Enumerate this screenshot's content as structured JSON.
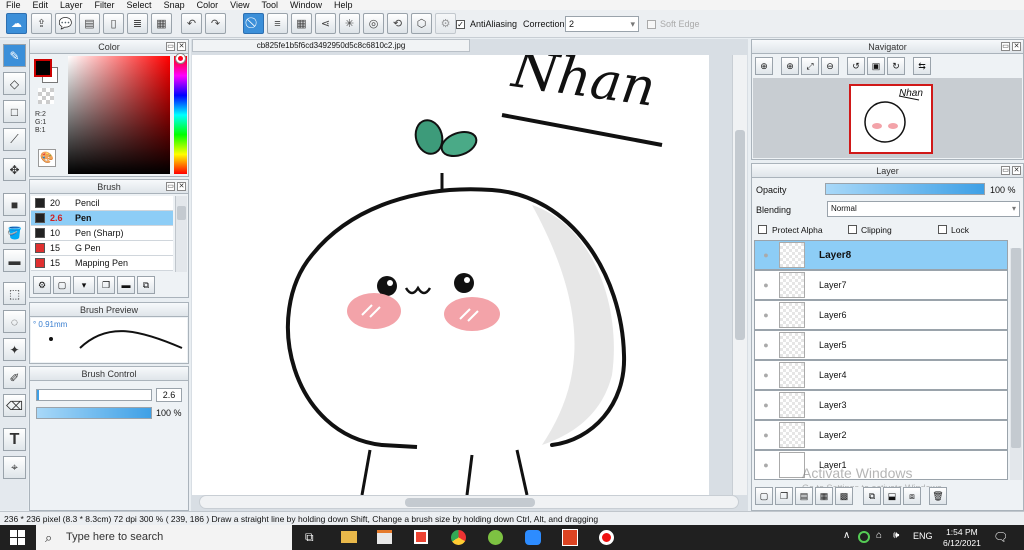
{
  "menu": [
    "File",
    "Edit",
    "Layer",
    "Filter",
    "Select",
    "Snap",
    "Color",
    "View",
    "Tool",
    "Window",
    "Help"
  ],
  "toolbar": {
    "antialiasing_label": "AntiAliasing",
    "correction_label": "Correction",
    "correction_value": "2",
    "soft_edge_label": "Soft Edge"
  },
  "color_panel": {
    "title": "Color",
    "r": "R:2",
    "g": "G:1",
    "b": "B:1"
  },
  "brush_panel": {
    "title": "Brush",
    "items": [
      {
        "size": "20",
        "name": "Pencil",
        "color": "#222222"
      },
      {
        "size": "2.6",
        "name": "Pen",
        "color": "#222222",
        "selected": true
      },
      {
        "size": "10",
        "name": "Pen (Sharp)",
        "color": "#222222"
      },
      {
        "size": "15",
        "name": "G Pen",
        "color": "#e03030"
      },
      {
        "size": "15",
        "name": "Mapping Pen",
        "color": "#e03030"
      }
    ]
  },
  "brush_preview": {
    "title": "Brush Preview",
    "size": "° 0.91mm"
  },
  "brush_control": {
    "title": "Brush Control",
    "size": "2.6",
    "opacity": "100 %",
    "size_fraction": 0.02,
    "opacity_fraction": 1.0
  },
  "canvas": {
    "tab": "cb825fe1b5f6cd3492950d5c8c6810c2.jpg",
    "signature": "Nhan"
  },
  "navigator": {
    "title": "Navigator"
  },
  "layer_panel": {
    "title": "Layer",
    "opacity_label": "Opacity",
    "opacity_value": "100 %",
    "opacity_fraction": 1.0,
    "blending_label": "Blending",
    "blending_value": "Normal",
    "protect_alpha": "Protect Alpha",
    "clipping": "Clipping",
    "lock": "Lock",
    "layers": [
      "Layer8",
      "Layer7",
      "Layer6",
      "Layer5",
      "Layer4",
      "Layer3",
      "Layer2",
      "Layer1"
    ]
  },
  "status": {
    "size": "236 * 236 pixel",
    "cm": "(8.3 * 8.3cm)",
    "dpi": "72 dpi",
    "zoom": "300 %",
    "coords": "( 239, 186 )",
    "hint": "Draw a straight line by holding down Shift, Change a brush size by holding down Ctrl, Alt, and dragging"
  },
  "watermark": {
    "line1": "Activate Windows",
    "line2": "Go to Settings to activate Windows."
  },
  "taskbar": {
    "search_placeholder": "Type here to search",
    "lang": "ENG",
    "time": "1:54 PM",
    "date": "6/12/2021"
  }
}
